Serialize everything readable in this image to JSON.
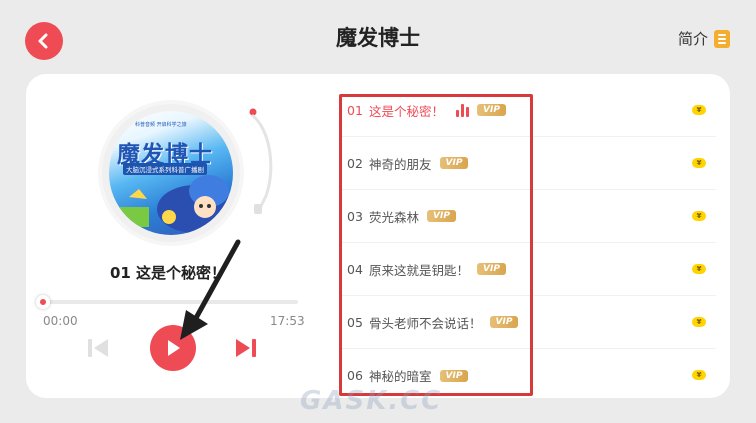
{
  "header": {
    "title": "魔发博士",
    "intro_label": "简介"
  },
  "player": {
    "cover_title": "魔发博士",
    "cover_subtitle": "大脑沉浸式系列科普广播剧",
    "cover_tagline": "科普音频 开启科学之旅",
    "now_playing": "01 这是个秘密！",
    "time_elapsed": "00:00",
    "time_total": "17:53",
    "progress": 0
  },
  "tracks": [
    {
      "num": "01",
      "name": "这是个秘密！",
      "badge": "VIP",
      "active": true
    },
    {
      "num": "02",
      "name": "神奇的朋友",
      "badge": "VIP",
      "active": false
    },
    {
      "num": "03",
      "name": "荧光森林",
      "badge": "VIP",
      "active": false
    },
    {
      "num": "04",
      "name": "原来这就是钥匙！",
      "badge": "VIP",
      "active": false
    },
    {
      "num": "05",
      "name": "骨头老师不会说话！",
      "badge": "VIP",
      "active": false
    },
    {
      "num": "06",
      "name": "神秘的暗室",
      "badge": "VIP",
      "active": false
    }
  ],
  "watermark": "GASK.CC",
  "colors": {
    "accent": "#ef4b55",
    "vip": "#d9a54e",
    "coin": "#ffd400",
    "intro_icon": "#f4ad2e",
    "annotation": "#d63a3a"
  },
  "icons": {
    "back": "chevron-left-icon",
    "intro": "document-icon",
    "play": "play-icon",
    "prev": "skip-previous-icon",
    "next": "skip-next-icon",
    "playing": "equalizer-icon",
    "coin": "coin-icon"
  }
}
